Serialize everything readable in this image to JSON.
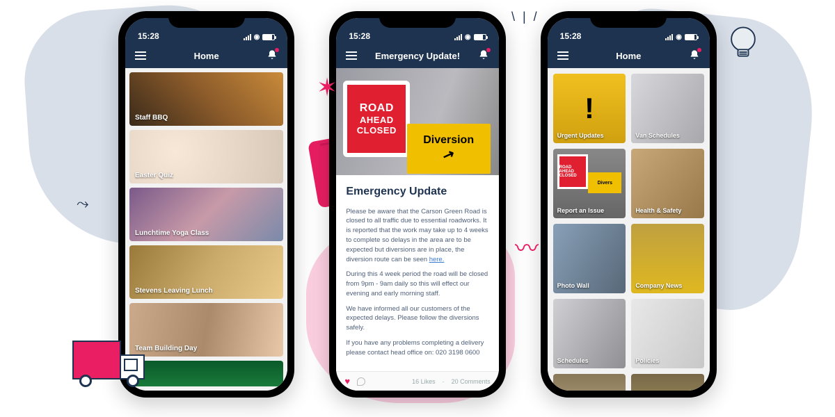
{
  "status": {
    "time": "15:28"
  },
  "phone1": {
    "title": "Home",
    "cards": [
      {
        "label": "Staff BBQ"
      },
      {
        "label": "Easter Quiz"
      },
      {
        "label": "Lunchtime Yoga Class"
      },
      {
        "label": "Stevens Leaving Lunch"
      },
      {
        "label": "Team Building Day"
      }
    ]
  },
  "phone2": {
    "title": "Emergency Update!",
    "road_sign": {
      "l1": "ROAD",
      "l2": "AHEAD",
      "l3": "CLOSED"
    },
    "diversion_sign": "Diversion",
    "article": {
      "heading": "Emergency Update",
      "p1_pre": "Please be aware that the Carson Green Road is closed to all traffic due to essential roadworks. It is reported that the work may take up to 4 weeks to complete so delays in the area are to be expected but diversions are in place, the diversion route can be seen ",
      "p1_link": "here.",
      "p2": "During this 4 week period the road will be closed from 9pm - 9am daily so this will effect our evening and early morning staff.",
      "p3": "We have informed all our customers of the expected delays. Please follow the diversions safely.",
      "p4": "If you have any problems completing a delivery please contact head office on: 020 3198 0600"
    },
    "footer": {
      "likes": "16 Likes",
      "comments": "20 Comments"
    }
  },
  "phone3": {
    "title": "Home",
    "tiles": [
      {
        "label": "Urgent Updates"
      },
      {
        "label": "Van Schedules"
      },
      {
        "label": "Report an Issue"
      },
      {
        "label": "Health & Safety"
      },
      {
        "label": "Photo Wall"
      },
      {
        "label": "Company News"
      },
      {
        "label": "Schedules"
      },
      {
        "label": "Policies"
      }
    ],
    "report_mini": {
      "road": "ROAD AHEAD CLOSED",
      "div": "Divers"
    }
  }
}
